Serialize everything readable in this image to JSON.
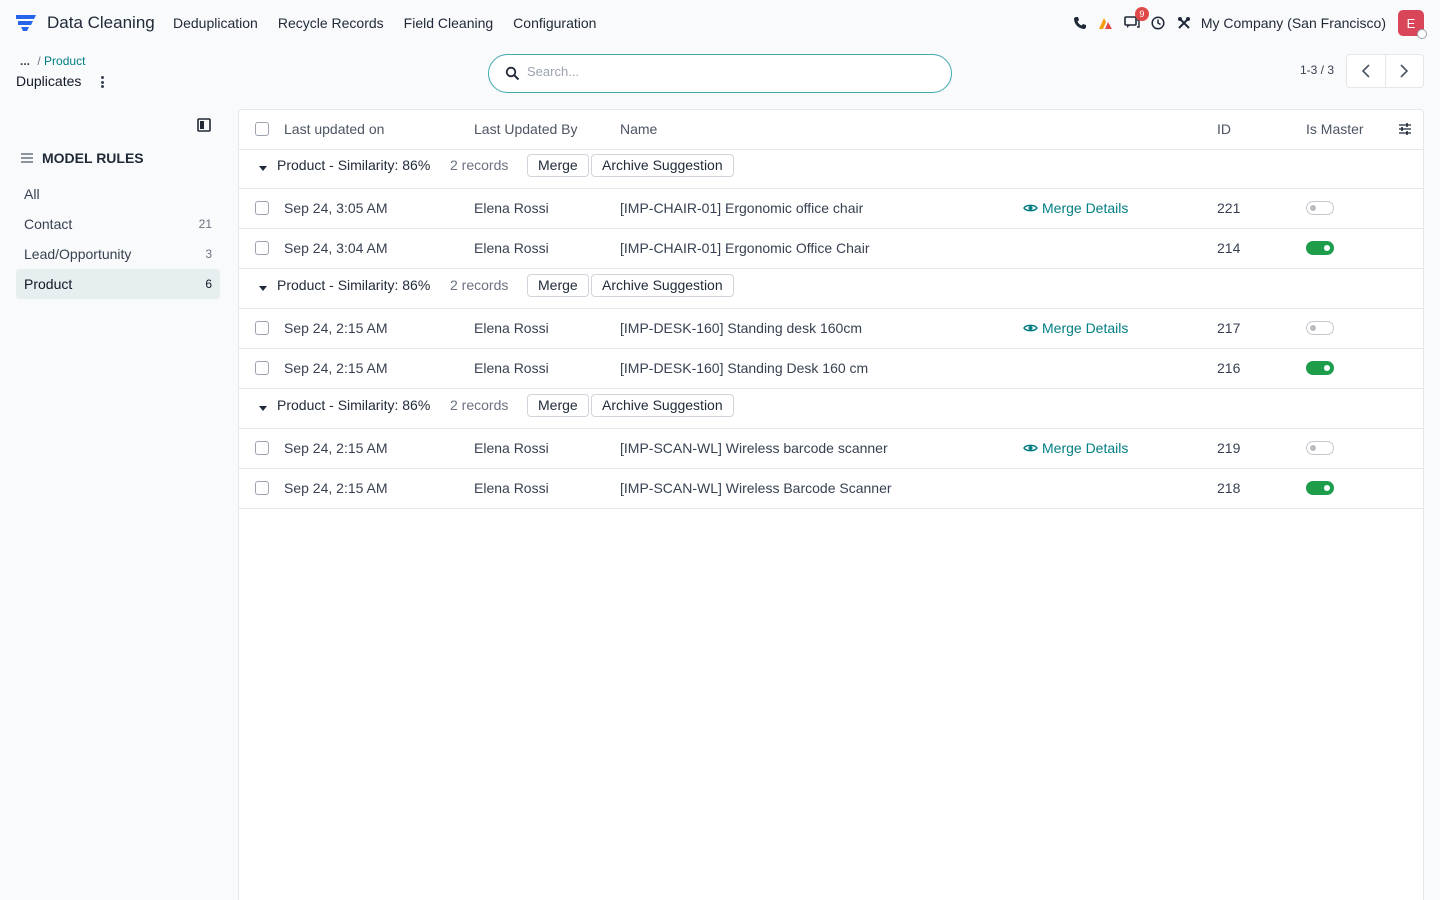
{
  "navbar": {
    "app_title": "Data Cleaning",
    "menu": [
      "Deduplication",
      "Recycle Records",
      "Field Cleaning",
      "Configuration"
    ],
    "messages_badge": "9",
    "company": "My Company (San Francisco)",
    "avatar_letter": "E"
  },
  "breadcrumb": {
    "ellipsis": "...",
    "separator": "/",
    "parent": "Product",
    "current": "Duplicates"
  },
  "search": {
    "placeholder": "Search..."
  },
  "pager": {
    "value": "1-3 / 3"
  },
  "sidebar": {
    "title": "MODEL RULES",
    "items": [
      {
        "label": "All",
        "count": ""
      },
      {
        "label": "Contact",
        "count": "21"
      },
      {
        "label": "Lead/Opportunity",
        "count": "3"
      },
      {
        "label": "Product",
        "count": "6"
      }
    ]
  },
  "table": {
    "headers": {
      "date": "Last updated on",
      "user": "Last Updated By",
      "name": "Name",
      "id": "ID",
      "master": "Is Master"
    },
    "merge_label": "Merge",
    "archive_label": "Archive Suggestion",
    "details_label": "Merge Details",
    "groups": [
      {
        "title": "Product - Similarity: 86%",
        "count": "2 records",
        "rows": [
          {
            "date": "Sep 24, 3:05 AM",
            "user": "Elena Rossi",
            "name": "[IMP-CHAIR-01] Ergonomic office chair",
            "id": "221",
            "is_master": false
          },
          {
            "date": "Sep 24, 3:04 AM",
            "user": "Elena Rossi",
            "name": "[IMP-CHAIR-01] Ergonomic Office Chair",
            "id": "214",
            "is_master": true
          }
        ]
      },
      {
        "title": "Product - Similarity: 86%",
        "count": "2 records",
        "rows": [
          {
            "date": "Sep 24, 2:15 AM",
            "user": "Elena Rossi",
            "name": "[IMP-DESK-160] Standing desk 160cm",
            "id": "217",
            "is_master": false
          },
          {
            "date": "Sep 24, 2:15 AM",
            "user": "Elena Rossi",
            "name": "[IMP-DESK-160] Standing Desk 160 cm",
            "id": "216",
            "is_master": true
          }
        ]
      },
      {
        "title": "Product - Similarity: 86%",
        "count": "2 records",
        "rows": [
          {
            "date": "Sep 24, 2:15 AM",
            "user": "Elena Rossi",
            "name": "[IMP-SCAN-WL] Wireless barcode scanner",
            "id": "219",
            "is_master": false
          },
          {
            "date": "Sep 24, 2:15 AM",
            "user": "Elena Rossi",
            "name": "[IMP-SCAN-WL] Wireless Barcode Scanner",
            "id": "218",
            "is_master": true
          }
        ]
      }
    ]
  },
  "colors": {
    "accent": "#017e84",
    "toggle_on": "#1e9e4b",
    "avatar": "#d9465a",
    "badge": "#e04848"
  }
}
